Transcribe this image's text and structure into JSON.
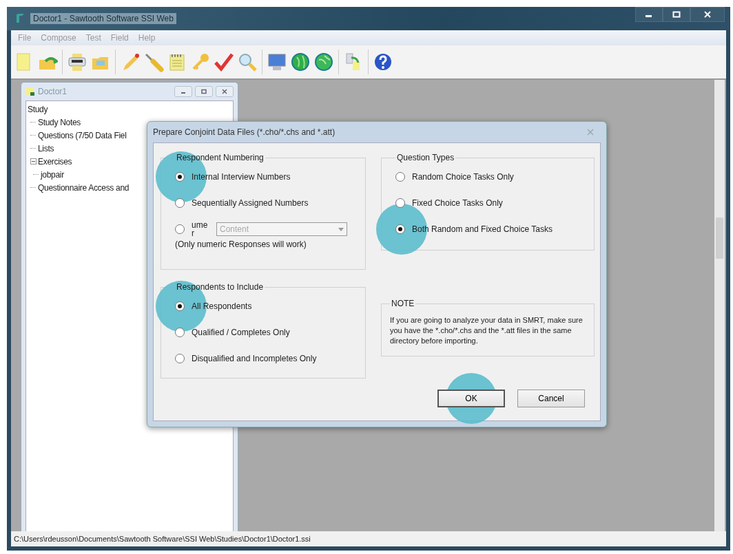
{
  "window": {
    "title": "Doctor1 - Sawtooth Software SSI Web"
  },
  "menu": [
    "File",
    "Compose",
    "Test",
    "Field",
    "Help"
  ],
  "child_window": {
    "title": "Doctor1",
    "tree": [
      {
        "label": "Study",
        "children": [
          {
            "label": "Study Notes"
          },
          {
            "label": "Questions (7/50 Data Fiel"
          },
          {
            "label": "Lists"
          },
          {
            "label": "Exercises",
            "expanded": true,
            "children": [
              {
                "label": "jobpair"
              }
            ]
          },
          {
            "label": "Questionnaire Access and"
          }
        ]
      }
    ]
  },
  "dialog": {
    "title": "Prepare Conjoint Data Files (*.cho/*.chs and *.att)",
    "numbering": {
      "title": "Respondent Numbering",
      "options": [
        {
          "label": "Internal Interview Numbers",
          "selected": true,
          "highlighted": true
        },
        {
          "label": "Sequentially Assigned Numbers",
          "selected": false,
          "highlighted": false
        },
        {
          "label": "ume r",
          "selected": false,
          "highlighted": false,
          "dropdown": {
            "value": "Content",
            "disabled": true
          }
        }
      ],
      "hint": "(Only numeric Responses will work)"
    },
    "include": {
      "title": "Respondents to Include",
      "options": [
        {
          "label": "All Respondents",
          "selected": true,
          "highlighted": true
        },
        {
          "label": "Qualified / Completes Only",
          "selected": false,
          "highlighted": false
        },
        {
          "label": "Disqualified and Incompletes Only",
          "selected": false,
          "highlighted": false
        }
      ]
    },
    "question_types": {
      "title": "Question Types",
      "options": [
        {
          "label": "Random Choice Tasks Only",
          "selected": false,
          "highlighted": false
        },
        {
          "label": "Fixed Choice Tasks Only",
          "selected": false,
          "highlighted": false
        },
        {
          "label": "Both Random and Fixed Choice Tasks",
          "selected": true,
          "highlighted": true
        }
      ]
    },
    "note": {
      "title": "NOTE",
      "text": "If you are going to analyze your data in SMRT, make sure you have the *.cho/*.chs and the *.att files in the same directory before importing."
    },
    "buttons": [
      {
        "label": "OK",
        "highlighted": true
      },
      {
        "label": "Cancel",
        "highlighted": false
      }
    ]
  },
  "status_bar": "C:\\Users\\rdeusson\\Documents\\Sawtooth Software\\SSI Web\\Studies\\Doctor1\\Doctor1.ssi"
}
